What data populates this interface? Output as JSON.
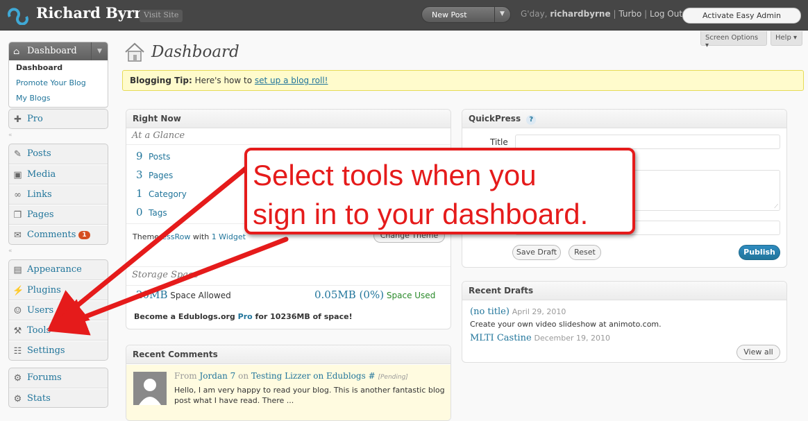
{
  "header": {
    "site_title": "Richard Byrne",
    "visit_site": "Visit Site",
    "new_post": "New Post",
    "greeting": "G'day,",
    "username": "richardbyrne",
    "sep": "|",
    "turbo": "Turbo",
    "logout": "Log Out",
    "activate": "Activate Easy Admin"
  },
  "screen_options": "Screen Options",
  "help": "Help",
  "sidebar": {
    "dashboard": "Dashboard",
    "dashboard_sub": [
      "Dashboard",
      "Promote Your Blog",
      "My Blogs"
    ],
    "pro": "Pro",
    "content": [
      "Posts",
      "Media",
      "Links",
      "Pages",
      "Comments"
    ],
    "comments_badge": "1",
    "admin": [
      "Appearance",
      "Plugins",
      "Users",
      "Tools",
      "Settings"
    ],
    "extra": [
      "Forums",
      "Stats"
    ]
  },
  "page_title": "Dashboard",
  "tip": {
    "label": "Blogging Tip:",
    "text": "Here's how to",
    "link": "set up a blog roll!"
  },
  "right_now": {
    "title": "Right Now",
    "glance": "At a Glance",
    "rows": [
      {
        "n": "9",
        "label": "Posts"
      },
      {
        "n": "3",
        "label": "Pages"
      },
      {
        "n": "1",
        "label": "Category"
      },
      {
        "n": "0",
        "label": "Tags"
      }
    ],
    "theme_prefix": "Theme",
    "theme_name": "ressRow",
    "theme_with": "with",
    "widgets": "1 Widget",
    "change_theme": "Change Theme",
    "storage": "Storage Space",
    "space_allowed_val": "20MB",
    "space_allowed": "Space Allowed",
    "space_used_val": "0.05MB (0%)",
    "space_used": "Space Used",
    "upgrade_pre": "Become a Edublogs.org",
    "upgrade_link": "Pro",
    "upgrade_post": "for 10236MB of space!"
  },
  "recent_comments": {
    "title": "Recent Comments",
    "from": "From",
    "author": "Jordan 7",
    "on": "on",
    "post": "Testing Lizzer on Edublogs",
    "hash": "#",
    "status": "[Pending]",
    "excerpt": "Hello, I am very happy to read your blog. This is another fantastic blog post what I have read. There ..."
  },
  "quickpress": {
    "title": "QuickPress",
    "help": "?",
    "title_label": "Title",
    "save_draft": "Save Draft",
    "reset": "Reset",
    "publish": "Publish"
  },
  "recent_drafts": {
    "title": "Recent Drafts",
    "items": [
      {
        "title": "(no title)",
        "date": "April 29, 2010",
        "excerpt": "Create your own video slideshow at animoto.com."
      },
      {
        "title": "MLTI Castine",
        "date": "December 19, 2010"
      }
    ],
    "view_all": "View all"
  },
  "callout": {
    "line1": "Select tools when you",
    "line2": "sign in to your dashboard."
  },
  "colors": {
    "accent": "#21759b",
    "annotation": "#e51b1b",
    "publish": "#21759b"
  }
}
